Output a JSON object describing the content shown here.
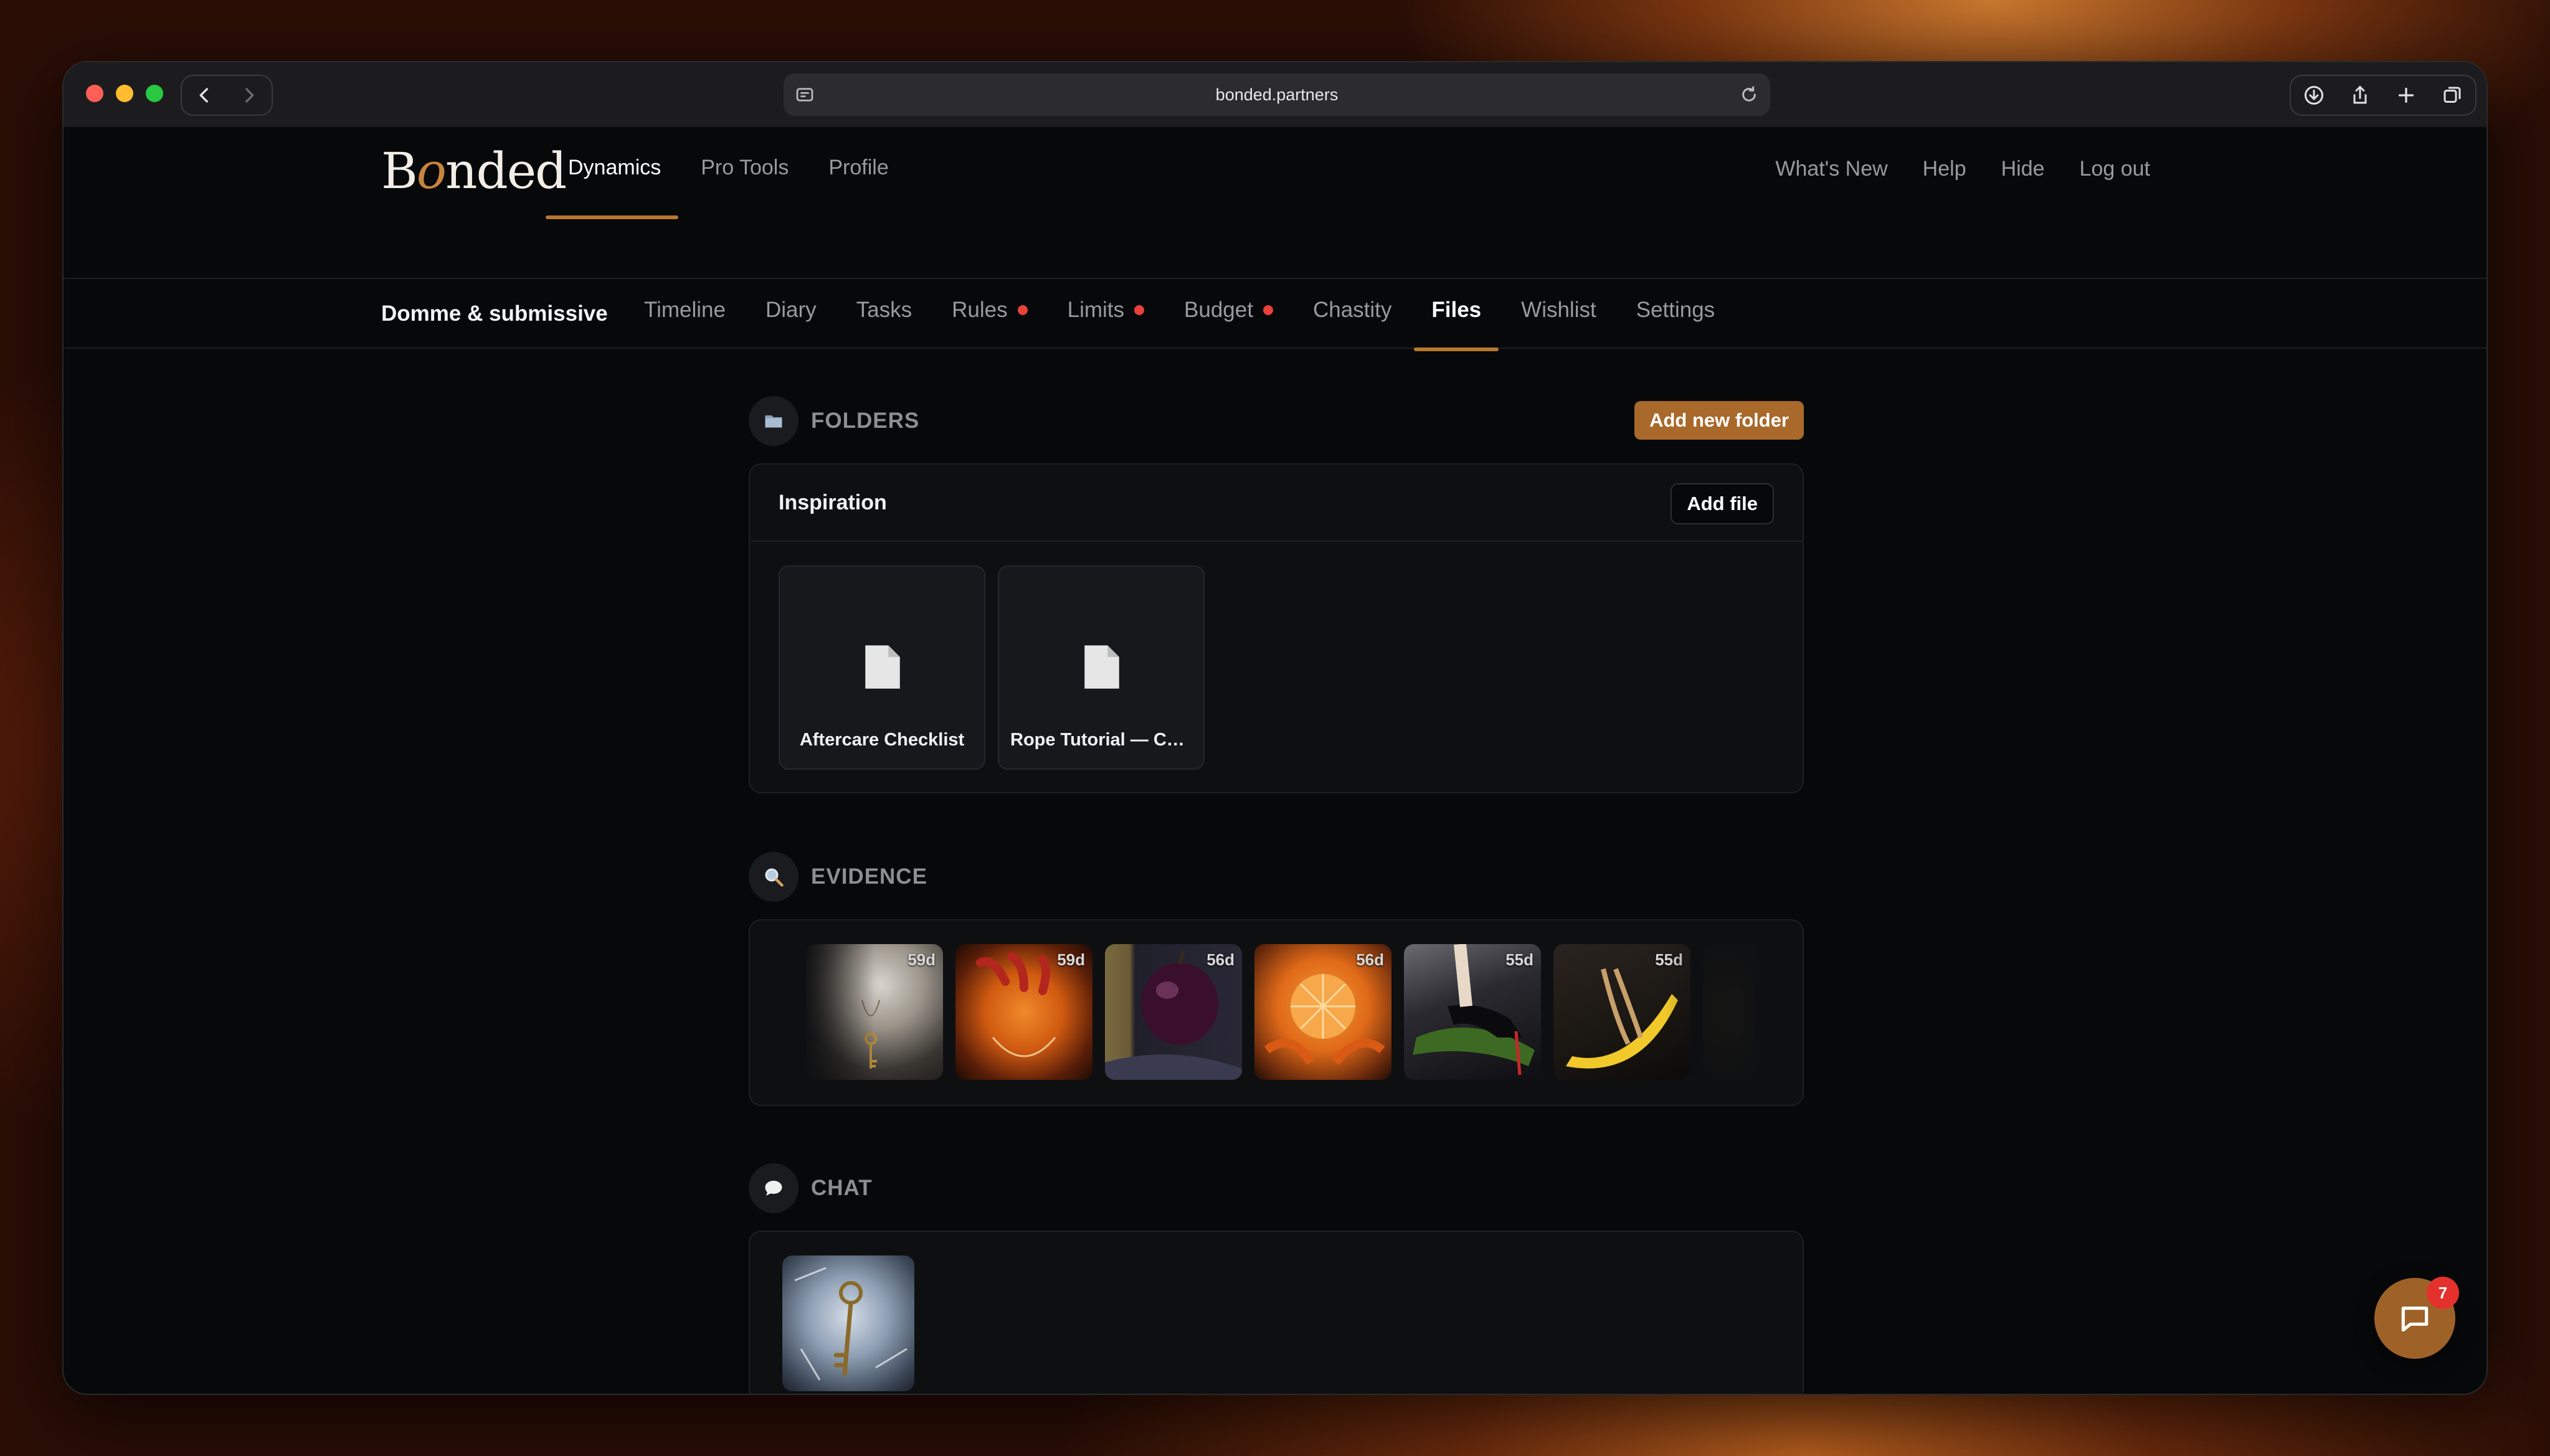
{
  "browser": {
    "url": "bonded.partners"
  },
  "brand": {
    "logo_pre": "B",
    "logo_o": "o",
    "logo_post": "nded"
  },
  "main_nav": [
    {
      "label": "Dynamics",
      "active": true
    },
    {
      "label": "Pro Tools",
      "active": false
    },
    {
      "label": "Profile",
      "active": false
    }
  ],
  "right_nav": [
    "What's New",
    "Help",
    "Hide",
    "Log out"
  ],
  "dynamic": {
    "title": "Domme & submissive",
    "tabs": [
      {
        "label": "Timeline",
        "dot": false
      },
      {
        "label": "Diary",
        "dot": false
      },
      {
        "label": "Tasks",
        "dot": false
      },
      {
        "label": "Rules",
        "dot": true
      },
      {
        "label": "Limits",
        "dot": true
      },
      {
        "label": "Budget",
        "dot": true
      },
      {
        "label": "Chastity",
        "dot": false
      },
      {
        "label": "Files",
        "dot": false,
        "active": true
      },
      {
        "label": "Wishlist",
        "dot": false
      },
      {
        "label": "Settings",
        "dot": false
      }
    ]
  },
  "folders": {
    "section_label": "FOLDERS",
    "add_button": "Add new folder",
    "items": [
      {
        "name": "Inspiration",
        "add_file_label": "Add file",
        "files": [
          {
            "name": "Aftercare Checklist"
          },
          {
            "name": "Rope Tutorial — Col..."
          }
        ]
      }
    ]
  },
  "evidence": {
    "section_label": "EVIDENCE",
    "items": [
      {
        "age": "59d",
        "subject": "bust-with-key"
      },
      {
        "age": "59d",
        "subject": "orange-squeeze"
      },
      {
        "age": "56d",
        "subject": "plum-ruler"
      },
      {
        "age": "56d",
        "subject": "peeled-orange"
      },
      {
        "age": "55d",
        "subject": "heel-zucchini"
      },
      {
        "age": "55d",
        "subject": "tied-banana"
      }
    ]
  },
  "chat": {
    "section_label": "CHAT",
    "items": [
      {
        "subject": "key-in-ice"
      }
    ]
  },
  "chat_fab": {
    "badge": "7"
  },
  "colors": {
    "accent": "#b7772f",
    "button": "#a9692a",
    "notify": "#e8403a"
  }
}
